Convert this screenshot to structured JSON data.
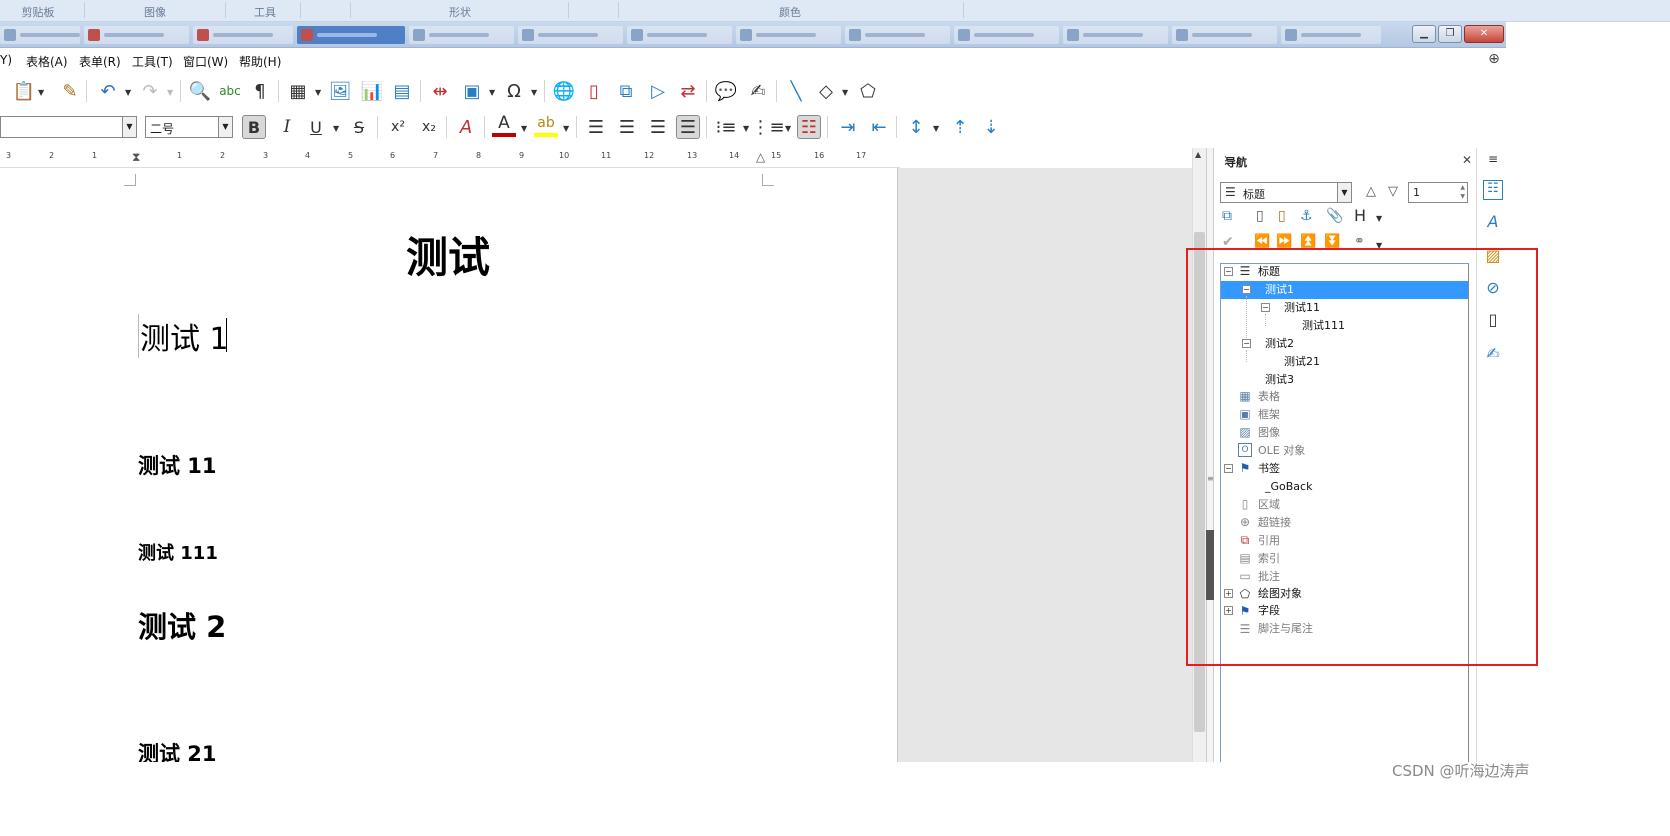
{
  "ribbon": {
    "groups": [
      "剪贴板",
      "图像",
      "工具",
      "形状",
      "颜色"
    ]
  },
  "menubar": {
    "items": [
      "Y)",
      "表格(A)",
      "表单(R)",
      "工具(T)",
      "窗口(W)",
      "帮助(H)"
    ]
  },
  "formatting": {
    "font_name": "",
    "font_size": "二号"
  },
  "ruler": {
    "numbers": [
      "3",
      "2",
      "1",
      "1",
      "2",
      "3",
      "4",
      "5",
      "6",
      "7",
      "8",
      "9",
      "10",
      "11",
      "12",
      "13",
      "14",
      "15",
      "16",
      "17"
    ]
  },
  "document": {
    "title": "测试",
    "h1_line": "测试 1",
    "h2_a": "测试 11",
    "h3_a": "测试 111",
    "h1_b": "测试 2",
    "h2_b": "测试 21"
  },
  "navigator": {
    "title": "导航",
    "category": "标题",
    "spin_value": "1",
    "tree": {
      "headings": "标题",
      "h_1": "测试1",
      "h_11": "测试11",
      "h_111": "测试111",
      "h_2": "测试2",
      "h_21": "测试21",
      "h_3": "测试3",
      "tables": "表格",
      "frames": "框架",
      "images": "图像",
      "ole": "OLE 对象",
      "bookmarks": "书签",
      "goback": "_GoBack",
      "sections": "区域",
      "hyperlinks": "超链接",
      "references": "引用",
      "indexes": "索引",
      "comments": "批注",
      "drawing": "绘图对象",
      "fields": "字段",
      "footnotes": "脚注与尾注"
    }
  },
  "colors": {
    "selection": "#3399ff",
    "highlight_box": "#e02020",
    "font_color": "#c00000",
    "highlight_color": "#ffff00"
  },
  "watermark": "CSDN @听海边涛声"
}
